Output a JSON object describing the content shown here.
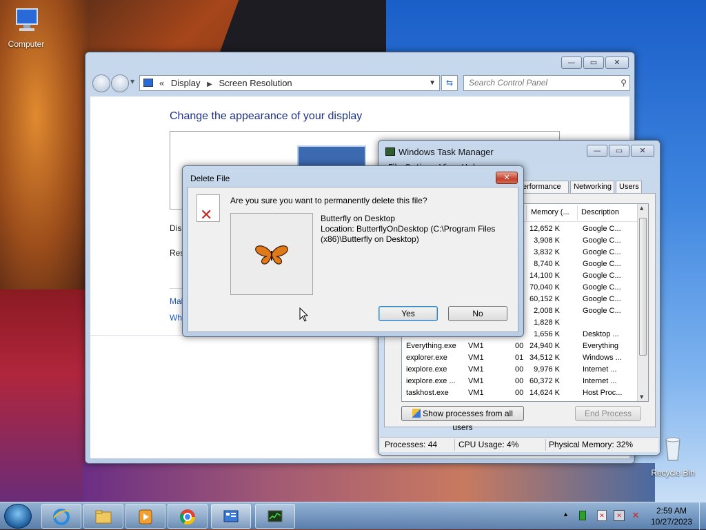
{
  "desktop": {
    "icons": [
      {
        "label": "Computer"
      },
      {
        "label": "Recycle Bin"
      }
    ]
  },
  "control_panel": {
    "breadcrumb": [
      "Display",
      "Screen Resolution"
    ],
    "search_placeholder": "Search Control Panel",
    "heading": "Change the appearance of your display",
    "labels": [
      "Disp",
      "Res"
    ],
    "links": [
      "Mal",
      "Wh"
    ]
  },
  "task_manager": {
    "title": "Windows Task Manager",
    "menu": "File  Options  View  Help",
    "tabs": [
      "erformance",
      "Networking",
      "Users"
    ],
    "columns": {
      "memory": "Memory (...",
      "description": "Description"
    },
    "rows": [
      {
        "image": "",
        "user": "",
        "cpu": "",
        "memory": "12,652 K",
        "description": "Google C..."
      },
      {
        "image": "",
        "user": "",
        "cpu": "",
        "memory": "3,908 K",
        "description": "Google C..."
      },
      {
        "image": "",
        "user": "",
        "cpu": "",
        "memory": "3,832 K",
        "description": "Google C..."
      },
      {
        "image": "",
        "user": "",
        "cpu": "",
        "memory": "8,740 K",
        "description": "Google C..."
      },
      {
        "image": "",
        "user": "",
        "cpu": "",
        "memory": "14,100 K",
        "description": "Google C..."
      },
      {
        "image": "",
        "user": "",
        "cpu": "",
        "memory": "70,040 K",
        "description": "Google C..."
      },
      {
        "image": "",
        "user": "",
        "cpu": "",
        "memory": "60,152 K",
        "description": "Google C..."
      },
      {
        "image": "",
        "user": "",
        "cpu": "",
        "memory": "2,008 K",
        "description": "Google C..."
      },
      {
        "image": "",
        "user": "",
        "cpu": "",
        "memory": "1,828 K",
        "description": ""
      },
      {
        "image": "",
        "user": "",
        "cpu": "",
        "memory": "1,656 K",
        "description": "Desktop ..."
      },
      {
        "image": "Everything.exe",
        "user": "VM1",
        "cpu": "00",
        "memory": "24,940 K",
        "description": "Everything"
      },
      {
        "image": "explorer.exe",
        "user": "VM1",
        "cpu": "01",
        "memory": "34,512 K",
        "description": "Windows ..."
      },
      {
        "image": "iexplore.exe",
        "user": "VM1",
        "cpu": "00",
        "memory": "9,976 K",
        "description": "Internet ..."
      },
      {
        "image": "iexplore.exe ...",
        "user": "VM1",
        "cpu": "00",
        "memory": "60,372 K",
        "description": "Internet ..."
      },
      {
        "image": "taskhost.exe",
        "user": "VM1",
        "cpu": "00",
        "memory": "14,624 K",
        "description": "Host Proc..."
      }
    ],
    "show_all_label": "Show processes from all users",
    "end_process_label": "End Process",
    "status": {
      "processes": "Processes: 44",
      "cpu": "CPU Usage: 4%",
      "memory": "Physical Memory: 32%"
    }
  },
  "delete_dialog": {
    "title": "Delete File",
    "question": "Are you sure you want to permanently delete this file?",
    "file_name": "Butterfly on Desktop",
    "location": "Location: ButterflyOnDesktop (C:\\Program Files (x86)\\Butterfly on Desktop)",
    "yes_label": "Yes",
    "no_label": "No"
  },
  "taskbar": {
    "clock_time": "2:59 AM",
    "clock_date": "10/27/2023",
    "pinned": [
      "internet-explorer",
      "file-explorer",
      "media-player",
      "chrome",
      "control-panel",
      "task-manager"
    ]
  }
}
